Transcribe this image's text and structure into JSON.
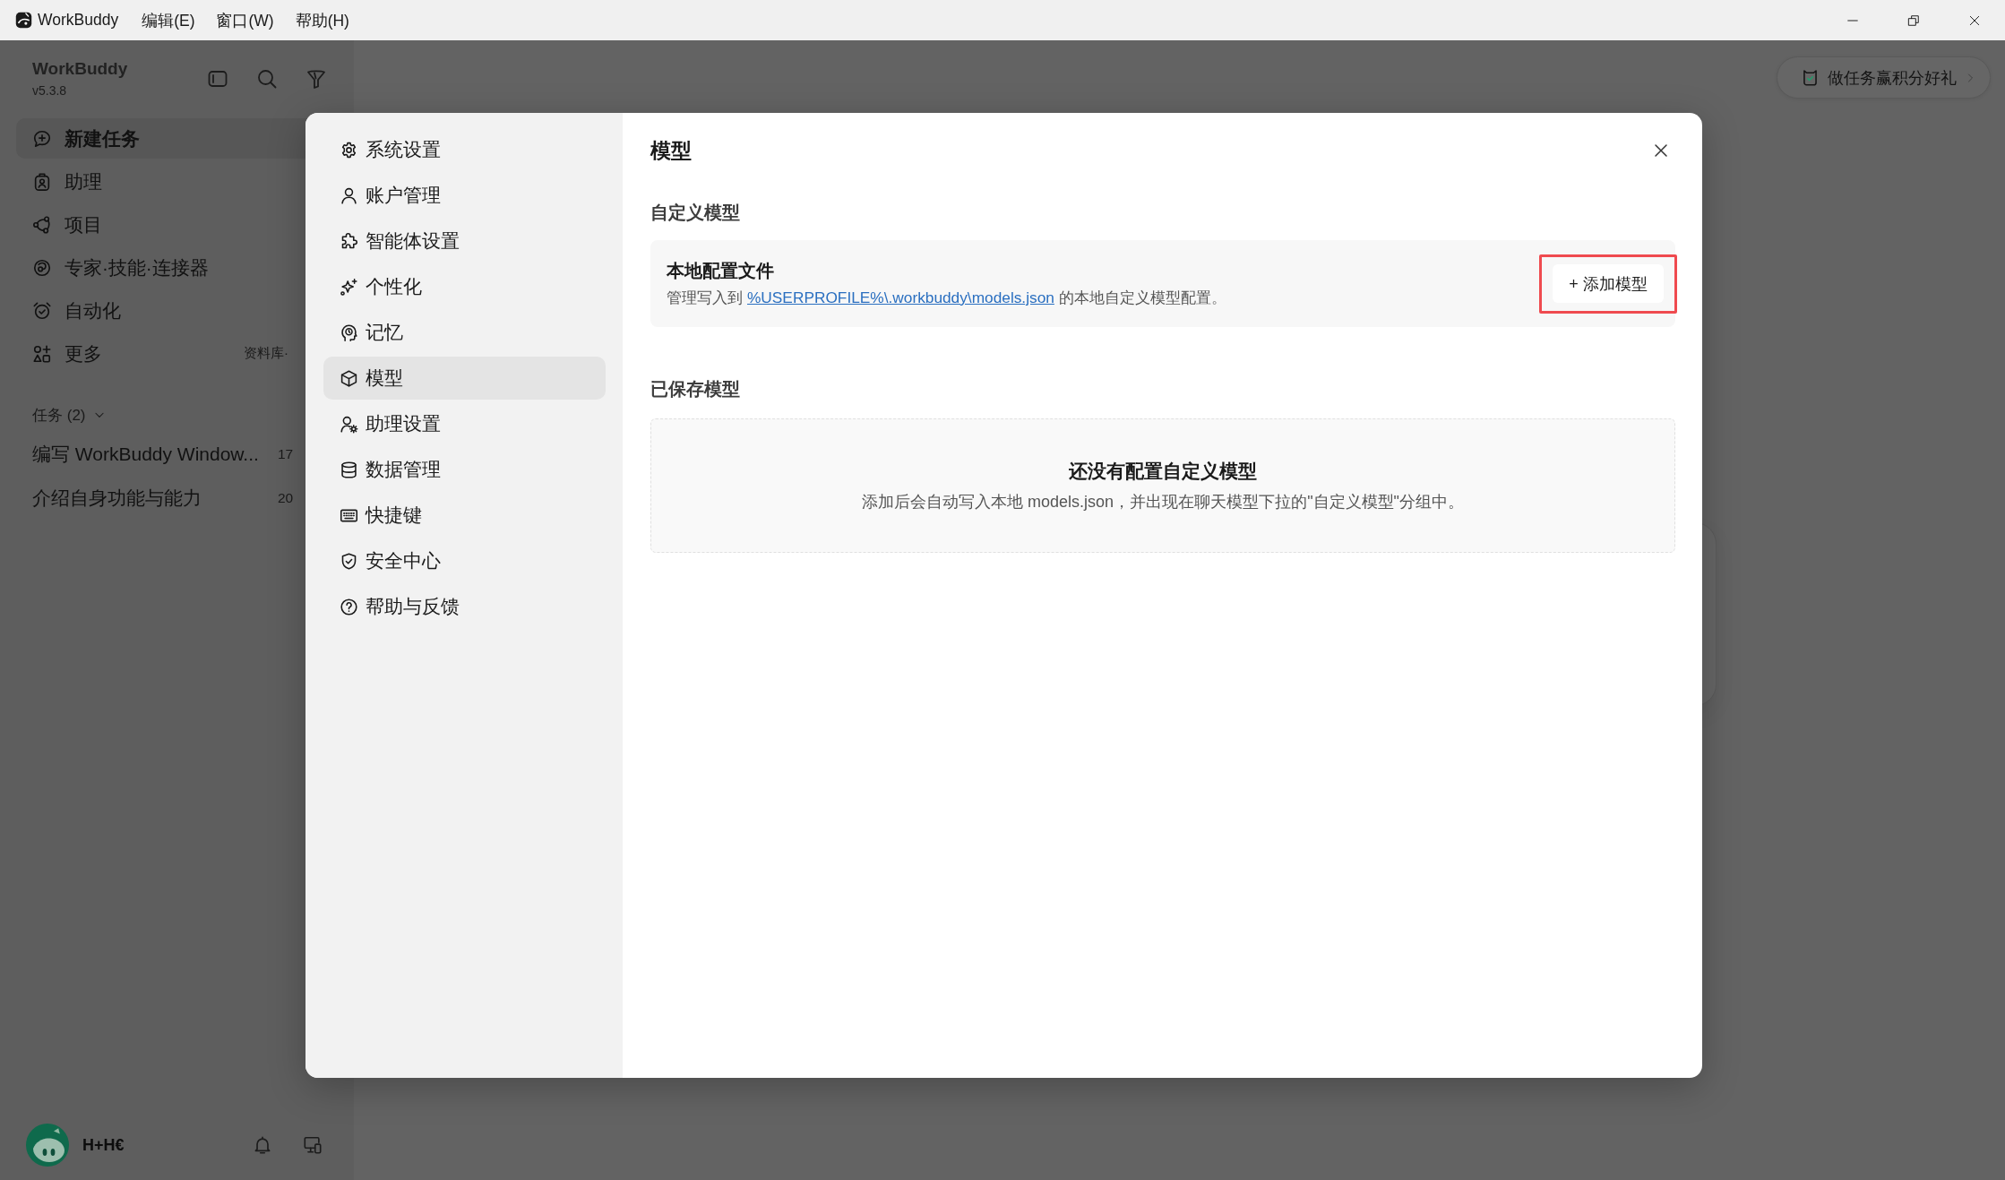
{
  "window": {
    "app_name": "WorkBuddy",
    "menus": [
      "编辑(E)",
      "窗口(W)",
      "帮助(H)"
    ]
  },
  "sidebar": {
    "title": "WorkBuddy",
    "version": "v5.3.8",
    "nav_items": [
      {
        "label": "新建任务",
        "selected": true
      },
      {
        "label": "助理",
        "selected": false
      },
      {
        "label": "项目",
        "selected": false
      },
      {
        "label": "专家·技能·连接器",
        "selected": false
      },
      {
        "label": "自动化",
        "selected": false
      },
      {
        "label": "更多",
        "selected": false,
        "hint": "资料库·"
      }
    ],
    "tasks_header": {
      "label": "任务 (2)",
      "expanded": true
    },
    "tasks": [
      {
        "title": "编写 WorkBuddy Window...",
        "time": "17"
      },
      {
        "title": "介绍自身功能与能力",
        "time": "20"
      }
    ],
    "user": {
      "name": "H+H€"
    }
  },
  "promo_button": {
    "label": "做任务赢积分好礼"
  },
  "settings": {
    "nav": [
      {
        "label": "系统设置",
        "selected": false
      },
      {
        "label": "账户管理",
        "selected": false
      },
      {
        "label": "智能体设置",
        "selected": false
      },
      {
        "label": "个性化",
        "selected": false
      },
      {
        "label": "记忆",
        "selected": false
      },
      {
        "label": "模型",
        "selected": true
      },
      {
        "label": "助理设置",
        "selected": false
      },
      {
        "label": "数据管理",
        "selected": false
      },
      {
        "label": "快捷键",
        "selected": false
      },
      {
        "label": "安全中心",
        "selected": false
      },
      {
        "label": "帮助与反馈",
        "selected": false
      }
    ],
    "title": "模型",
    "custom_section": {
      "heading": "自定义模型",
      "card": {
        "title": "本地配置文件",
        "description_before": "管理写入到",
        "link": "%USERPROFILE%\\.workbuddy\\models.json",
        "description_after": "的本地自定义模型配置。",
        "button": {
          "label": "+ 添加模型",
          "highlighted": true
        }
      }
    },
    "saved_section": {
      "heading": "已保存模型",
      "empty_title": "还没有配置自定义模型",
      "empty_text": "添加后会自动写入本地 models.json，并出现在聊天模型下拉的\"自定义模型\"分组中。"
    }
  }
}
